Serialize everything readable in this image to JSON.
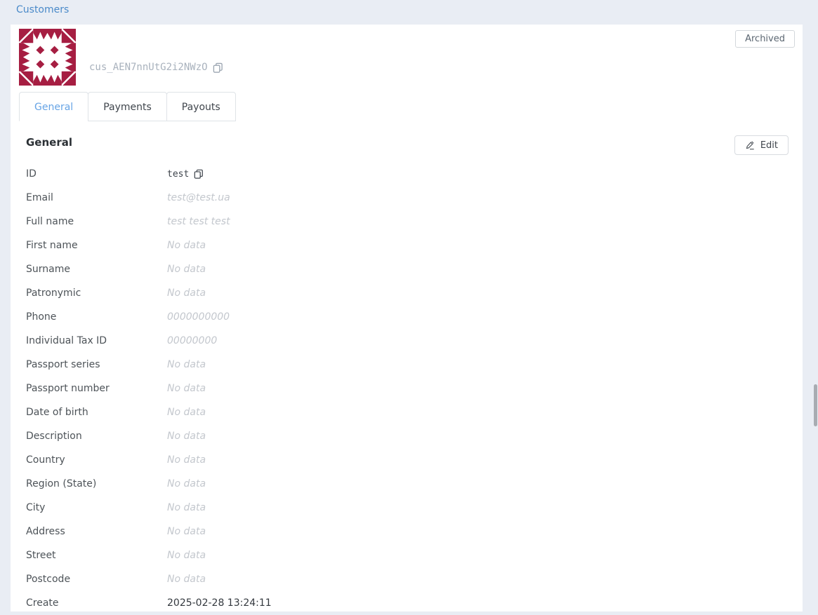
{
  "nav": {
    "customers_label": "Customers"
  },
  "customer": {
    "id_code": "cus_AEN7nnUtG2i2NWzO",
    "archived_label": "Archived",
    "avatar_color": "#a61e42"
  },
  "tabs": [
    {
      "label": "General",
      "active": true
    },
    {
      "label": "Payments",
      "active": false
    },
    {
      "label": "Payouts",
      "active": false
    }
  ],
  "section": {
    "title": "General",
    "edit_label": "Edit"
  },
  "fields": [
    {
      "label": "ID",
      "value": "test",
      "style": "mono",
      "copy": true
    },
    {
      "label": "Email",
      "value": "test@test.ua",
      "style": "muted",
      "copy": false
    },
    {
      "label": "Full name",
      "value": "test test test",
      "style": "muted",
      "copy": false
    },
    {
      "label": "First name",
      "value": "No data",
      "style": "muted",
      "copy": false
    },
    {
      "label": "Surname",
      "value": "No data",
      "style": "muted",
      "copy": false
    },
    {
      "label": "Patronymic",
      "value": "No data",
      "style": "muted",
      "copy": false
    },
    {
      "label": "Phone",
      "value": "0000000000",
      "style": "muted",
      "copy": false
    },
    {
      "label": "Individual Tax ID",
      "value": "00000000",
      "style": "muted",
      "copy": false
    },
    {
      "label": "Passport series",
      "value": "No data",
      "style": "muted",
      "copy": false
    },
    {
      "label": "Passport number",
      "value": "No data",
      "style": "muted",
      "copy": false
    },
    {
      "label": "Date of birth",
      "value": "No data",
      "style": "muted",
      "copy": false
    },
    {
      "label": "Description",
      "value": "No data",
      "style": "muted",
      "copy": false
    },
    {
      "label": "Country",
      "value": "No data",
      "style": "muted",
      "copy": false
    },
    {
      "label": "Region (State)",
      "value": "No data",
      "style": "muted",
      "copy": false
    },
    {
      "label": "City",
      "value": "No data",
      "style": "muted",
      "copy": false
    },
    {
      "label": "Address",
      "value": "No data",
      "style": "muted",
      "copy": false
    },
    {
      "label": "Street",
      "value": "No data",
      "style": "muted",
      "copy": false
    },
    {
      "label": "Postcode",
      "value": "No data",
      "style": "muted",
      "copy": false
    },
    {
      "label": "Create",
      "value": "2025-02-28 13:24:11",
      "style": "plain",
      "copy": false
    }
  ],
  "colors": {
    "accent_blue": "#3f90d4"
  }
}
